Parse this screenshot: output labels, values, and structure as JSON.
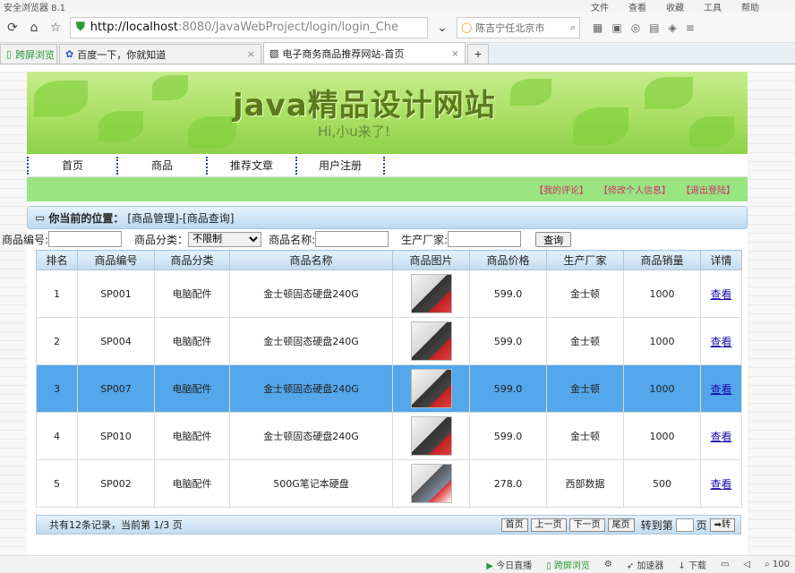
{
  "browser": {
    "title": "安全浏览器 8.1",
    "menus": [
      "文件",
      "查看",
      "收藏",
      "工具",
      "帮助"
    ],
    "url_host": "http://localhost",
    "url_path": ":8080/JavaWebProject/login/login_Che",
    "search_text": "陈吉宁任北京市",
    "tabs": [
      {
        "label": "跨屏浏览"
      },
      {
        "label": "百度一下，你就知道"
      },
      {
        "label": "电子商务商品推荐网站-首页"
      }
    ]
  },
  "site": {
    "banner_title": "java精品设计网站",
    "banner_sub": "Hi,小u来了!",
    "nav": [
      "首页",
      "商品",
      "推荐文章",
      "用户注册"
    ],
    "user_links": [
      "【我的评论】",
      "【修改个人信息】",
      "【退出登陆】"
    ],
    "location_label": "你当前的位置：",
    "location_path": "[商品管理]-[商品查询]"
  },
  "search": {
    "code_label": "商品编号:",
    "category_label": "商品分类：",
    "category_value": "不限制",
    "name_label": "商品名称:",
    "maker_label": "生产厂家:",
    "query_label": "查询"
  },
  "table": {
    "headers": [
      "排名",
      "商品编号",
      "商品分类",
      "商品名称",
      "商品图片",
      "商品价格",
      "生产厂家",
      "商品销量",
      "详情"
    ],
    "rows": [
      {
        "rank": "1",
        "code": "SP001",
        "category": "电脑配件",
        "name": "金士顿固态硬盘240G",
        "price": "599.0",
        "maker": "金士顿",
        "sales": "1000",
        "detail": "查看"
      },
      {
        "rank": "2",
        "code": "SP004",
        "category": "电脑配件",
        "name": "金士顿固态硬盘240G",
        "price": "599.0",
        "maker": "金士顿",
        "sales": "1000",
        "detail": "查看"
      },
      {
        "rank": "3",
        "code": "SP007",
        "category": "电脑配件",
        "name": "金士顿固态硬盘240G",
        "price": "599.0",
        "maker": "金士顿",
        "sales": "1000",
        "detail": "查看"
      },
      {
        "rank": "4",
        "code": "SP010",
        "category": "电脑配件",
        "name": "金士顿固态硬盘240G",
        "price": "599.0",
        "maker": "金士顿",
        "sales": "1000",
        "detail": "查看"
      },
      {
        "rank": "5",
        "code": "SP002",
        "category": "电脑配件",
        "name": "500G笔记本硬盘",
        "price": "278.0",
        "maker": "西部数据",
        "sales": "500",
        "detail": "查看"
      }
    ]
  },
  "pager": {
    "summary": "共有12条记录，当前第 1/3 页",
    "first": "首页",
    "prev": "上一页",
    "next": "下一页",
    "last": "尾页",
    "goto_label": "转到第",
    "page_unit": "页",
    "go": "➡转"
  },
  "status": [
    "今日直播",
    "跨屏浏览",
    "加速器",
    "下载",
    "100"
  ],
  "colors": {
    "highlight_row": "#53a7ea",
    "green_bar": "#98e582",
    "link_pink": "#d5306b"
  }
}
